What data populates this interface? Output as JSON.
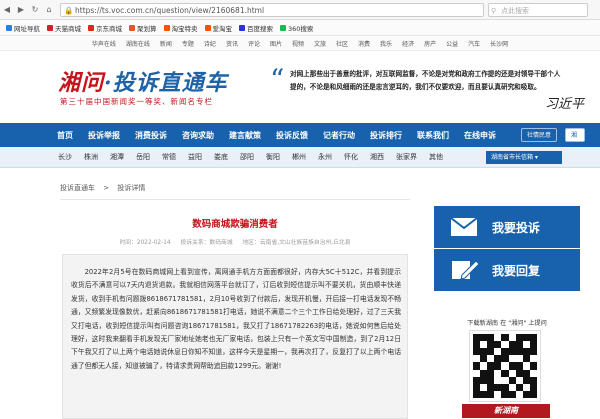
{
  "browser": {
    "url": "https://ts.voc.com.cn/question/view/2160681.html",
    "search_placeholder": "点此搜索",
    "bookmarks": [
      {
        "label": "网址导航",
        "color": "#2b7de9"
      },
      {
        "label": "天猫商城",
        "color": "#d5202a"
      },
      {
        "label": "京东商城",
        "color": "#e1251b"
      },
      {
        "label": "聚划算",
        "color": "#e8552a"
      },
      {
        "label": "淘宝特卖",
        "color": "#ff5000"
      },
      {
        "label": "爱淘宝",
        "color": "#ff5000"
      },
      {
        "label": "百度搜索",
        "color": "#2932e1"
      },
      {
        "label": "360搜索",
        "color": "#19b955"
      }
    ]
  },
  "topnav": [
    "华声在线",
    "湖南在线",
    "新闻",
    "专题",
    "诗纪",
    "资讯",
    "评论",
    "图片",
    "视频",
    "文旅",
    "社区",
    "消费",
    "我乐",
    "经济",
    "房产",
    "公益",
    "汽车",
    "长沙网"
  ],
  "header": {
    "logo_main": "湘问",
    "logo_sub": "·投诉直通车",
    "slogan": "第三十届中国新闻奖一等奖、新闻名专栏",
    "quote": "对网上那些出于善意的批评，对互联网监督，不论是对党和政府工作提的还是对领导干部个人提的，不论是和风细雨的还是忠言逆耳的，我们不仅要欢迎，而且要认真研究和吸取。",
    "signature": "习近平"
  },
  "mainnav": {
    "items": [
      "首页",
      "投诉举报",
      "消费投诉",
      "咨询求助",
      "建言献策",
      "投诉反馈",
      "记者行动",
      "投诉排行",
      "联系我们",
      "在线申诉"
    ],
    "btn_login": "社情民意",
    "btn_red": "湘问"
  },
  "subnav": {
    "cities": [
      "长沙",
      "株洲",
      "湘潭",
      "岳阳",
      "常德",
      "益阳",
      "娄底",
      "邵阳",
      "衡阳",
      "郴州",
      "永州",
      "怀化",
      "湘西",
      "张家界",
      "其他"
    ],
    "select": "湖南省市长信箱 ▾"
  },
  "breadcrumb": {
    "home": "投诉直通车",
    "sep": ">",
    "current": "投诉详情"
  },
  "article": {
    "title": "数码商城欺骗消费者",
    "time": "时间：2022-02-14",
    "category": "投诉关系：数码商城",
    "area": "地区：云南省,文山壮族苗族自治州,丘北县",
    "body": "2022年2月5号在数码商城网上看到宣传，离网通手机方方面面都很好，内存大5C十512C，并看到提示收货后不满意可以7天内退货退款。我就相信网落平台就订了，订后收到短信提示叫不要关机，货由顺丰快递发货，收到手机有问题拨8618671781581，2月10号收到了付款后，发现开机慢，开后接一打电话发现不畅通，又频繁发现像数优，赶紧向8618671781581打电话，她说不满意二个三个工作日给处理好，过了三天我又打电话，收到短信提示叫有问题咨询18671781581，我又打了18671782263的电话，她说如何售后给处理好，这时我来翻看手机发现无厂家地址她老也无厂家电话，包装上只有一个英文写中国制造，到了2月12日下午我又打了以上两个电话她说休息日你知不知道，这样今天是星期一，我再次打了，反复打了以上两个电话通了但都无人接，知道被骗了，特请求贵网帮助追回款1299元。谢谢!"
  },
  "sidebar": {
    "complain_label": "我要投诉",
    "reply_label": "我要回复",
    "download_text": "下载新湖南 在 \"湘问\" 上提问",
    "promo": "新湖南",
    "btn_color": "#1761ad"
  }
}
